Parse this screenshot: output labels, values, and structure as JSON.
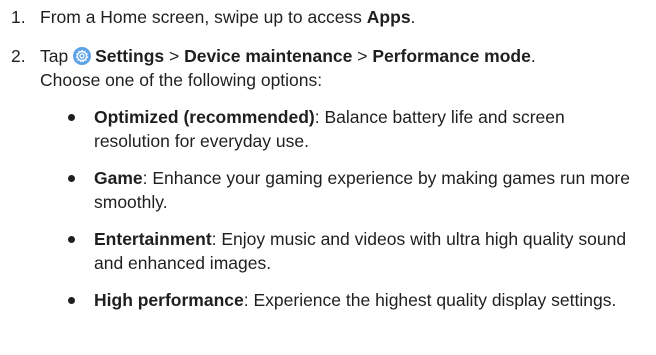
{
  "step1": {
    "number": "1.",
    "prefix": "From a Home screen, swipe up to access ",
    "apps": "Apps",
    "suffix": "."
  },
  "step2": {
    "number": "2.",
    "tap": "Tap ",
    "settings_icon": "settings-gear-icon",
    "settings": "Settings",
    "sep1": " > ",
    "device_maintenance": "Device maintenance",
    "sep2": " > ",
    "performance_mode": "Performance mode",
    "end": ".",
    "choose": "Choose one of the following options:"
  },
  "options": [
    {
      "name": "Optimized (recommended)",
      "desc": ": Balance battery life and screen resolution for everyday use."
    },
    {
      "name": "Game",
      "desc": ": Enhance your gaming experience by making games run more smoothly."
    },
    {
      "name": "Entertainment",
      "desc": ": Enjoy music and videos with ultra high quality sound and enhanced images."
    },
    {
      "name": "High performance",
      "desc": ": Experience the highest quality display settings."
    }
  ],
  "colors": {
    "text": "#1f1f1f",
    "settings_icon_bg": "#5ea3e8",
    "settings_icon_fg": "#ffffff"
  }
}
